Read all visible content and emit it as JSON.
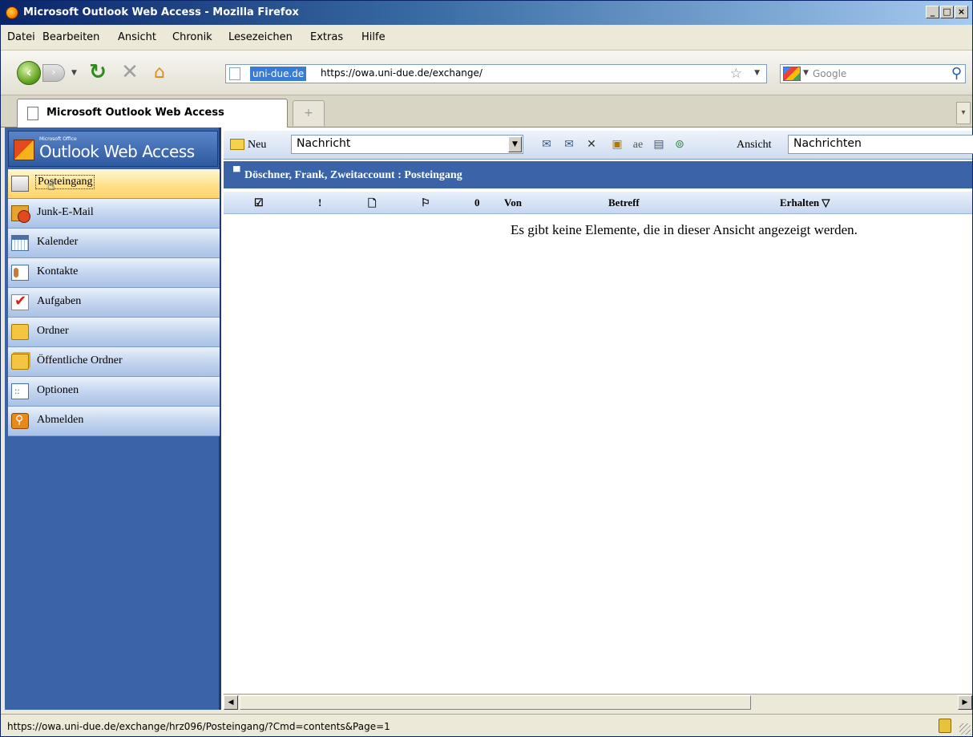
{
  "window": {
    "title": "Microsoft Outlook Web Access - Mozilla Firefox",
    "controls": [
      "_",
      "□",
      "×"
    ]
  },
  "menu": [
    "Datei",
    "Bearbeiten",
    "Ansicht",
    "Chronik",
    "Lesezeichen",
    "Extras",
    "Hilfe"
  ],
  "nav": {
    "site_label": "uni-due.de",
    "url": "https://owa.uni-due.de/exchange/",
    "search_placeholder": "Google"
  },
  "tab": {
    "label": "Microsoft Outlook Web Access"
  },
  "owa": {
    "logo_sub": "Microsoft Office",
    "logo_name": "Outlook Web Access",
    "sidebar": [
      {
        "label": "Posteingang",
        "icon": "inbox-icon",
        "active": true
      },
      {
        "label": "Junk-E-Mail",
        "icon": "junk-mail-icon"
      },
      {
        "label": "Kalender",
        "icon": "calendar-icon"
      },
      {
        "label": "Kontakte",
        "icon": "contacts-icon"
      },
      {
        "label": "Aufgaben",
        "icon": "tasks-icon"
      },
      {
        "label": "Ordner",
        "icon": "folder-icon"
      },
      {
        "label": "Öffentliche Ordner",
        "icon": "public-folder-icon"
      },
      {
        "label": "Optionen",
        "icon": "options-icon"
      },
      {
        "label": "Abmelden",
        "icon": "logout-icon"
      }
    ],
    "toolbar": {
      "new_label": "Neu",
      "new_type": "Nachricht",
      "view_label": "Ansicht",
      "view_value": "Nachrichten"
    },
    "folder_title": "Döschner, Frank, Zweitaccount : Posteingang",
    "columns": {
      "check": "☑",
      "importance": "!",
      "type": "🗋",
      "flag": "⚐",
      "attach": "0",
      "from": "Von",
      "subject": "Betreff",
      "received": "Erhalten ▽"
    },
    "empty_message": "Es gibt keine Elemente, die in dieser Ansicht angezeigt werden."
  },
  "status": {
    "text": "https://owa.uni-due.de/exchange/hrz096/Posteingang/?Cmd=contents&Page=1"
  }
}
